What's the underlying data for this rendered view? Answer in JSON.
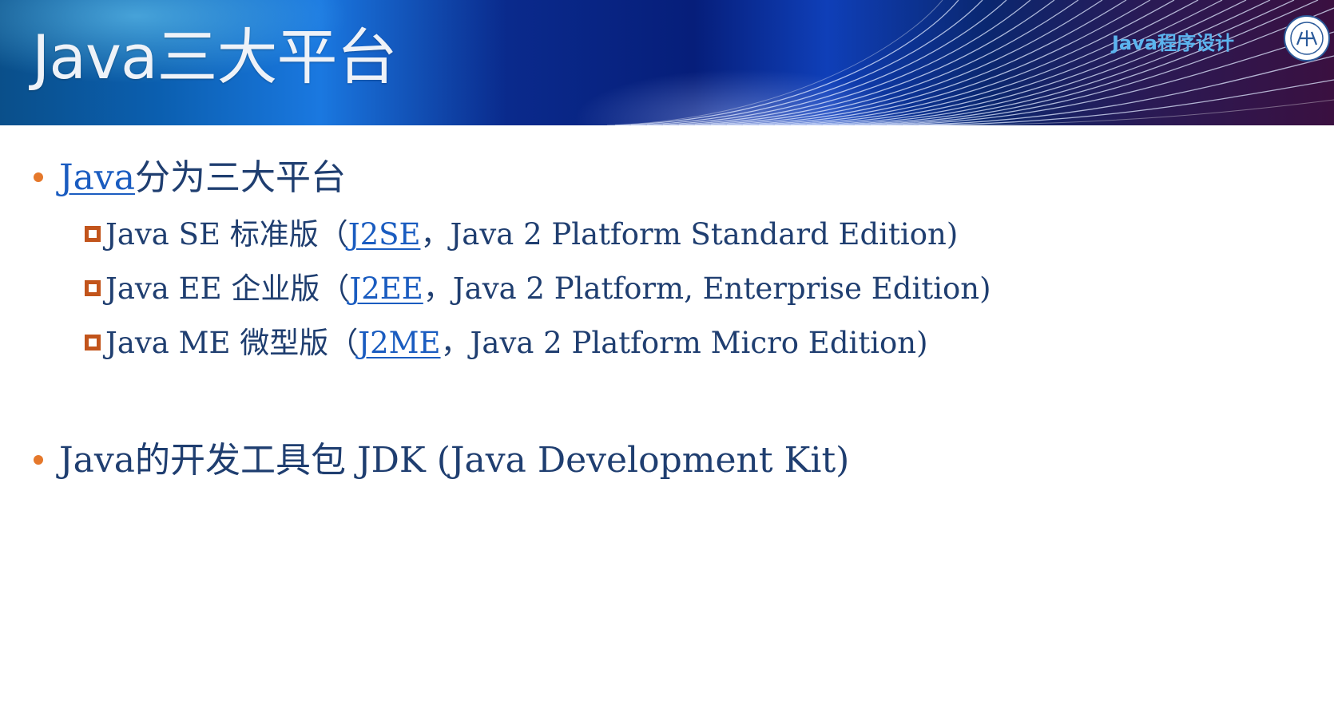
{
  "header": {
    "title": "Java三大平台",
    "course_label": "Java程序设计",
    "emblem_icon": "university-seal-icon"
  },
  "bullets": [
    {
      "link_text": "Java",
      "text_after": "分为三大平台",
      "items": [
        {
          "before": "Java SE 标准版（",
          "link": "J2SE",
          "after": "，Java 2 Platform Standard Edition)"
        },
        {
          "before": "Java EE 企业版（",
          "link": "J2EE",
          "after": "，Java 2 Platform, Enterprise Edition)"
        },
        {
          "before": "Java ME 微型版（",
          "link": "J2ME",
          "after": "，Java 2 Platform Micro Edition)"
        }
      ]
    },
    {
      "text": "Java的开发工具包  JDK (Java Development Kit)"
    }
  ],
  "colors": {
    "text": "#1f3e70",
    "link": "#1a5cc0",
    "bullet_dot": "#e5782b",
    "sub_bullet_box": "#c2541b",
    "title": "#eef2f8",
    "course_label": "#5bb4ee"
  }
}
